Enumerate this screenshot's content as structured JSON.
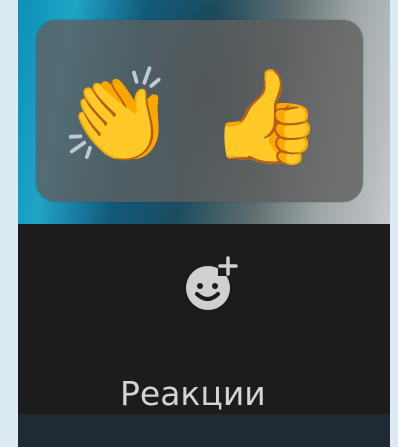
{
  "reactions_popup": {
    "items": [
      {
        "icon": "clapping-hands-icon",
        "glyph": "👏"
      },
      {
        "icon": "thumbs-up-icon",
        "glyph": "👍"
      }
    ]
  },
  "toolbar": {
    "reactions_label": "Реакции",
    "reactions_icon": "add-reaction-icon"
  },
  "colors": {
    "panel_bg": "#1c1c1c",
    "label_text": "#d4d4d4",
    "icon_fill": "#d0d0d0"
  }
}
